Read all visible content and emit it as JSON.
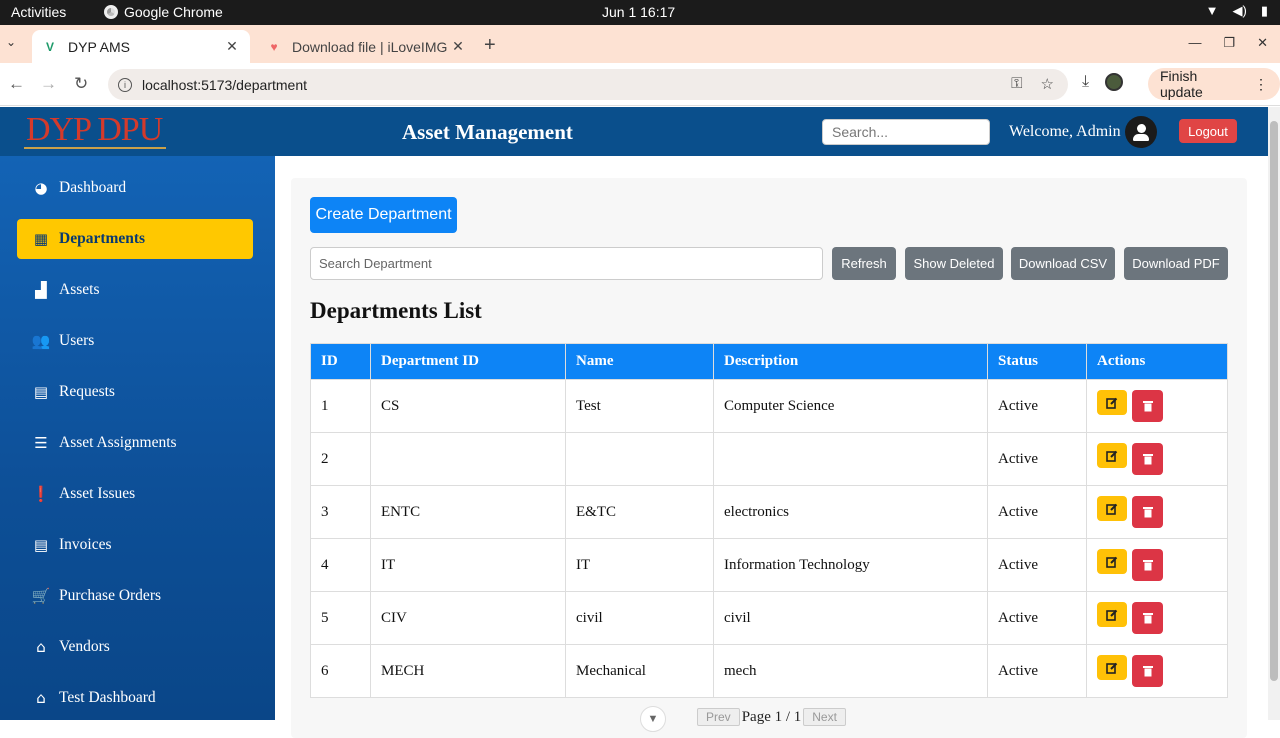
{
  "os": {
    "activities": "Activities",
    "app_name": "Google Chrome",
    "clock": "Jun 1  16:17"
  },
  "browser": {
    "tabs": [
      {
        "title": "DYP AMS",
        "active": true
      },
      {
        "title": "Download file | iLoveIMG",
        "active": false
      }
    ],
    "url": "localhost:5173/department",
    "finish_update": "Finish update"
  },
  "header": {
    "logo_text": "DYP DPU",
    "title": "Asset Management",
    "search_placeholder": "Search...",
    "welcome": "Welcome, Admin",
    "logout": "Logout"
  },
  "sidebar": {
    "items": [
      {
        "label": "Dashboard",
        "icon": "palette-icon",
        "active": false
      },
      {
        "label": "Departments",
        "icon": "building-icon",
        "active": true
      },
      {
        "label": "Assets",
        "icon": "boxes-icon",
        "active": false
      },
      {
        "label": "Users",
        "icon": "users-icon",
        "active": false
      },
      {
        "label": "Requests",
        "icon": "file-icon",
        "active": false
      },
      {
        "label": "Asset Assignments",
        "icon": "list-check-icon",
        "active": false
      },
      {
        "label": "Asset Issues",
        "icon": "exclamation-icon",
        "active": false
      },
      {
        "label": "Invoices",
        "icon": "invoice-icon",
        "active": false
      },
      {
        "label": "Purchase Orders",
        "icon": "cart-icon",
        "active": false
      },
      {
        "label": "Vendors",
        "icon": "store-icon",
        "active": false
      },
      {
        "label": "Test Dashboard",
        "icon": "store-icon",
        "active": false
      }
    ]
  },
  "main": {
    "create_button": "Create Department",
    "search_placeholder": "Search Department",
    "buttons": {
      "refresh": "Refresh",
      "show_deleted": "Show Deleted",
      "download_csv": "Download CSV",
      "download_pdf": "Download PDF"
    },
    "list_title": "Departments List",
    "table": {
      "columns": [
        "ID",
        "Department ID",
        "Name",
        "Description",
        "Status",
        "Actions"
      ],
      "rows": [
        [
          "1",
          "CS",
          "Test",
          "Computer Science",
          "Active"
        ],
        [
          "2",
          "",
          "",
          "",
          "Active"
        ],
        [
          "3",
          "ENTC",
          "E&TC",
          "electronics",
          "Active"
        ],
        [
          "4",
          "IT",
          "IT",
          "Information Technology",
          "Active"
        ],
        [
          "5",
          "CIV",
          "civil",
          "civil",
          "Active"
        ],
        [
          "6",
          "MECH",
          "Mechanical",
          "mech",
          "Active"
        ]
      ]
    },
    "pagination": {
      "prev": "Prev",
      "page_text": "Page 1 / 1",
      "next": "Next"
    }
  },
  "colors": {
    "header_bg": "#0a4f8c",
    "active_item": "#ffc800",
    "primary": "#0d84f6",
    "edit": "#ffc107",
    "delete": "#dc3545"
  }
}
